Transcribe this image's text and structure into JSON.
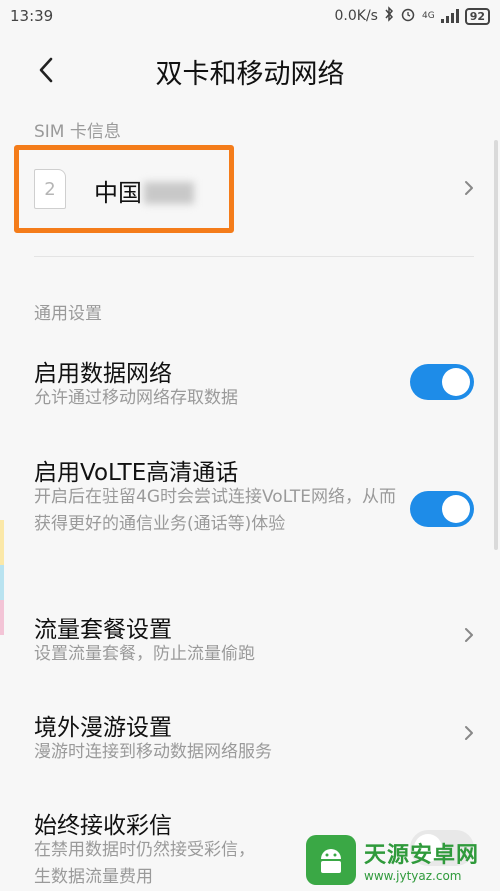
{
  "status": {
    "time": "13:39",
    "speed": "0.0K/s",
    "network_type": "4G",
    "battery": "92"
  },
  "header": {
    "title": "双卡和移动网络"
  },
  "sim_section": {
    "title": "SIM 卡信息",
    "slot_number": "2",
    "carrier_visible": "中国"
  },
  "general_section": {
    "title": "通用设置",
    "items": [
      {
        "title": "启用数据网络",
        "subtitle": "允许通过移动网络存取数据",
        "toggle": "on"
      },
      {
        "title": "启用VoLTE高清通话",
        "subtitle": "开启后在驻留4G时会尝试连接VoLTE网络，从而获得更好的通信业务(通话等)体验",
        "toggle": "on"
      },
      {
        "title": "流量套餐设置",
        "subtitle": "设置流量套餐，防止流量偷跑"
      },
      {
        "title": "境外漫游设置",
        "subtitle": "漫游时连接到移动数据网络服务"
      },
      {
        "title": "始终接收彩信",
        "subtitle": "在禁用数据时仍然接受彩信，"
      },
      {
        "subtitle_cont": "生数据流量费用"
      }
    ]
  },
  "watermark": {
    "name": "天源安卓网",
    "url": "www.jytyaz.com"
  },
  "colors": {
    "accent": "#1e8ce8",
    "highlight": "#f47c1a"
  }
}
